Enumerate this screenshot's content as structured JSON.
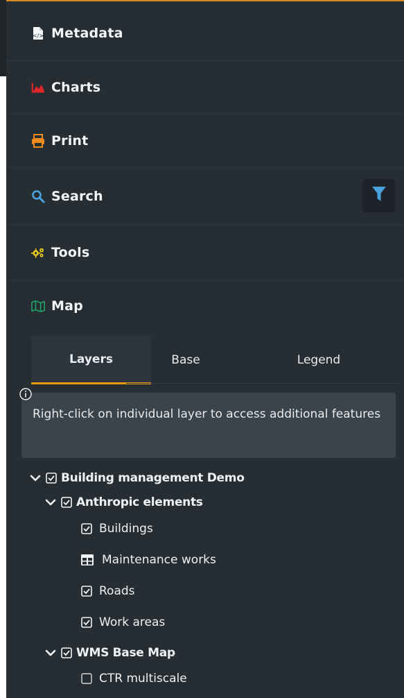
{
  "menu": {
    "items": [
      {
        "label": "Metadata",
        "icon": "file-code-icon"
      },
      {
        "label": "Charts",
        "icon": "area-chart-icon"
      },
      {
        "label": "Print",
        "icon": "printer-icon"
      },
      {
        "label": "Search",
        "icon": "search-icon"
      },
      {
        "label": "Tools",
        "icon": "cogs-icon"
      },
      {
        "label": "Map",
        "icon": "map-icon"
      }
    ]
  },
  "filter_button": {
    "icon": "filter-icon"
  },
  "tabs": [
    {
      "label": "Layers",
      "active": true
    },
    {
      "label": "Base",
      "active": false
    },
    {
      "label": "Legend",
      "active": false
    }
  ],
  "info": {
    "icon": "info-icon",
    "text": "Right-click on individual layer to access additional features"
  },
  "tree": {
    "root": {
      "label": "Building management Demo",
      "checked": true,
      "expanded": true
    },
    "group1": {
      "label": "Anthropic elements",
      "checked": true,
      "expanded": true
    },
    "layers1": [
      {
        "label": "Buildings",
        "checked": true,
        "icon": "checkbox"
      },
      {
        "label": "Maintenance works",
        "checked": null,
        "icon": "table-icon"
      },
      {
        "label": "Roads",
        "checked": true,
        "icon": "checkbox"
      },
      {
        "label": "Work areas",
        "checked": true,
        "icon": "checkbox"
      }
    ],
    "group2": {
      "label": "WMS Base Map",
      "checked": true,
      "expanded": true
    },
    "layers2": [
      {
        "label": "CTR multiscale",
        "checked": false,
        "icon": "checkbox"
      }
    ]
  },
  "colors": {
    "panel_bg": "#262d33",
    "accent": "#e8950f",
    "charts_icon": "#e0262b",
    "print_icon": "#f08a1a",
    "search_icon": "#4aa3df",
    "tools_icon": "#f2d21a",
    "map_icon": "#1fa36a"
  }
}
